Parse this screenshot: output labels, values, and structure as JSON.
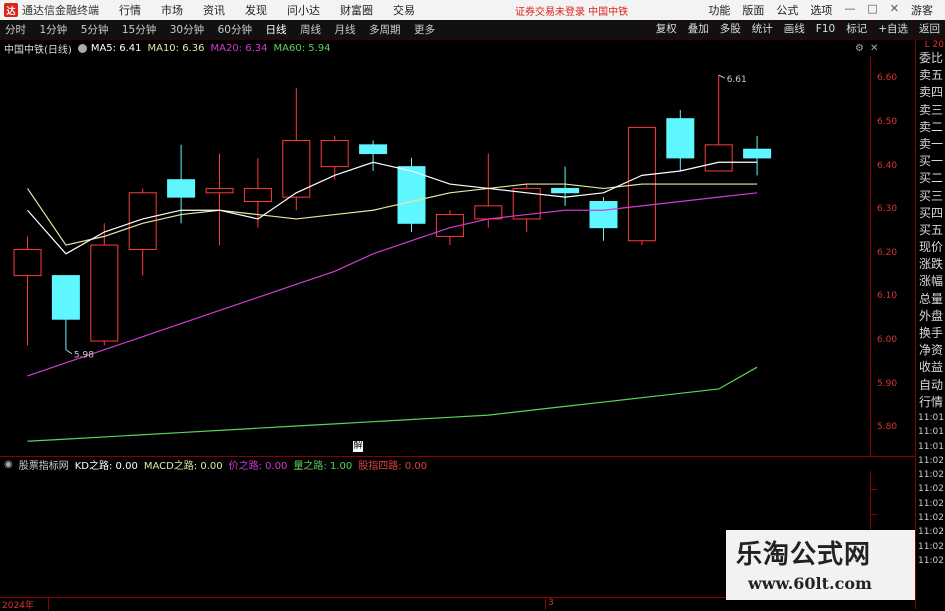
{
  "titlebar": {
    "app_name": "通达信金融终端",
    "menu": [
      "行情",
      "市场",
      "资讯",
      "发现",
      "问小达",
      "财富圈",
      "交易"
    ],
    "status": "证券交易未登录  中国中铁",
    "right_menu": [
      "功能",
      "版面",
      "公式",
      "选项"
    ],
    "guest": "游客"
  },
  "toolbar": {
    "periods": [
      "分时",
      "1分钟",
      "5分钟",
      "15分钟",
      "30分钟",
      "60分钟",
      "日线",
      "周线",
      "月线",
      "多周期",
      "更多"
    ],
    "active_period": "日线",
    "tools": [
      "复权",
      "叠加",
      "多股",
      "统计",
      "画线",
      "F10",
      "标记",
      "+自选",
      "返回"
    ]
  },
  "infobar": {
    "stock_name": "中国中铁(日线)",
    "ma5": "MA5: 6.41",
    "ma10": "MA10: 6.36",
    "ma20": "MA20: 6.34",
    "ma60": "MA60: 5.94"
  },
  "colors": {
    "ma5": "#ffffff",
    "ma10": "#e6e6a0",
    "ma20": "#d43ad4",
    "ma60": "#5bd35b",
    "up": "#ff3b3b",
    "down": "#5ef6ff"
  },
  "chart_data": {
    "type": "candlestick",
    "ylim": [
      5.75,
      6.64
    ],
    "y_ticks": [
      "6.60",
      "6.50",
      "6.40",
      "6.30",
      "6.20",
      "6.10",
      "6.00",
      "5.90",
      "5.80"
    ],
    "candles": [
      {
        "o": 6.15,
        "c": 6.21,
        "h": 6.24,
        "l": 5.99
      },
      {
        "o": 6.15,
        "c": 6.05,
        "h": 6.15,
        "l": 5.98
      },
      {
        "o": 6.0,
        "c": 6.22,
        "h": 6.27,
        "l": 5.99
      },
      {
        "o": 6.21,
        "c": 6.34,
        "h": 6.35,
        "l": 6.15
      },
      {
        "o": 6.37,
        "c": 6.33,
        "h": 6.45,
        "l": 6.27
      },
      {
        "o": 6.34,
        "c": 6.35,
        "h": 6.43,
        "l": 6.22
      },
      {
        "o": 6.32,
        "c": 6.35,
        "h": 6.42,
        "l": 6.26
      },
      {
        "o": 6.33,
        "c": 6.46,
        "h": 6.58,
        "l": 6.3
      },
      {
        "o": 6.4,
        "c": 6.46,
        "h": 6.47,
        "l": 6.37
      },
      {
        "o": 6.45,
        "c": 6.43,
        "h": 6.46,
        "l": 6.39
      },
      {
        "o": 6.4,
        "c": 6.27,
        "h": 6.42,
        "l": 6.25
      },
      {
        "o": 6.24,
        "c": 6.29,
        "h": 6.3,
        "l": 6.22
      },
      {
        "o": 6.28,
        "c": 6.31,
        "h": 6.43,
        "l": 6.26
      },
      {
        "o": 6.28,
        "c": 6.35,
        "h": 6.36,
        "l": 6.25
      },
      {
        "o": 6.35,
        "c": 6.34,
        "h": 6.4,
        "l": 6.31
      },
      {
        "o": 6.32,
        "c": 6.26,
        "h": 6.33,
        "l": 6.23
      },
      {
        "o": 6.23,
        "c": 6.49,
        "h": 6.49,
        "l": 6.22
      },
      {
        "o": 6.51,
        "c": 6.42,
        "h": 6.53,
        "l": 6.39
      },
      {
        "o": 6.39,
        "c": 6.45,
        "h": 6.61,
        "l": 6.39
      },
      {
        "o": 6.44,
        "c": 6.42,
        "h": 6.47,
        "l": 6.38
      }
    ],
    "ma5": [
      6.3,
      6.2,
      6.25,
      6.28,
      6.3,
      6.3,
      6.28,
      6.34,
      6.38,
      6.41,
      6.39,
      6.36,
      6.35,
      6.34,
      6.33,
      6.34,
      6.38,
      6.39,
      6.41,
      6.41
    ],
    "ma10": [
      6.35,
      6.22,
      6.24,
      6.27,
      6.29,
      6.3,
      6.29,
      6.28,
      6.29,
      6.3,
      6.32,
      6.34,
      6.35,
      6.36,
      6.36,
      6.35,
      6.36,
      6.36,
      6.36,
      6.36
    ],
    "ma20": [
      5.92,
      5.95,
      5.98,
      6.01,
      6.04,
      6.07,
      6.1,
      6.13,
      6.16,
      6.2,
      6.23,
      6.26,
      6.28,
      6.29,
      6.3,
      6.3,
      6.31,
      6.32,
      6.33,
      6.34
    ],
    "ma60": [
      5.77,
      5.775,
      5.78,
      5.785,
      5.79,
      5.795,
      5.8,
      5.805,
      5.81,
      5.815,
      5.82,
      5.825,
      5.83,
      5.84,
      5.85,
      5.86,
      5.87,
      5.88,
      5.89,
      5.94
    ],
    "annotations": {
      "high_label": "6.61",
      "low_label": "5.98"
    }
  },
  "indicator": {
    "name": "股票指标网",
    "kd": "KD之路: 0.00",
    "macd": "MACD之路: 0.00",
    "price": "价之路: 0.00",
    "vol": "量之路: 1.00",
    "four": "股指四路: 0.00"
  },
  "side_panel": {
    "header": "L 20",
    "labels": [
      "委比",
      "卖五",
      "卖四",
      "卖三",
      "卖二",
      "卖一",
      "买一",
      "买二",
      "买三",
      "买四",
      "买五",
      "现价",
      "涨跌",
      "涨幅",
      "总量",
      "外盘",
      "换手",
      "净资",
      "收益",
      "自动",
      "行情"
    ],
    "times": [
      "11:01",
      "11:01",
      "11:01",
      "11:02",
      "11:02",
      "11:02",
      "11:02",
      "11:02",
      "11:02",
      "11:02",
      "11:02"
    ]
  },
  "bottombar": {
    "year": "2024年",
    "mark": "3"
  },
  "bmark": "解",
  "watermark": {
    "title": "乐淘公式网",
    "url": "www.60lt.com"
  }
}
